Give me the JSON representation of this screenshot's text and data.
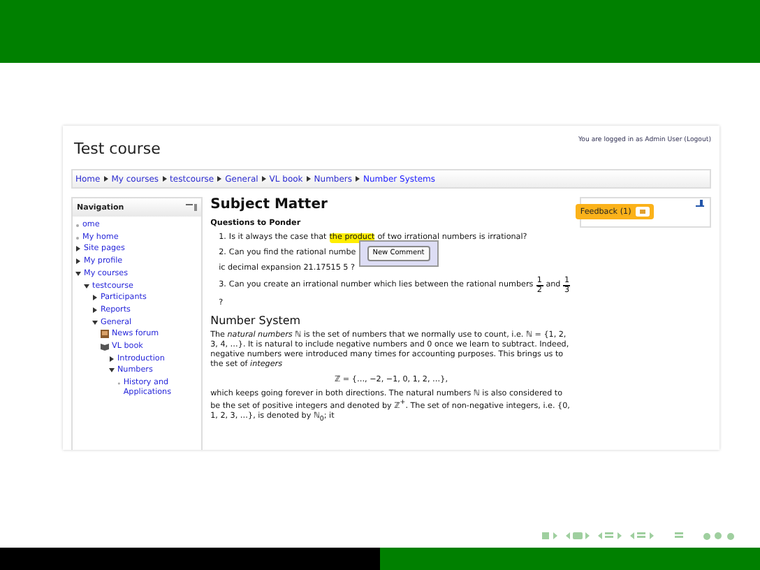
{
  "page": {
    "title": "Test course",
    "login": "You are logged in as Admin User (Logout)"
  },
  "breadcrumb": [
    "Home",
    "My courses",
    "testcourse",
    "General",
    "VL book",
    "Numbers",
    "Number Systems"
  ],
  "navigation": {
    "title": "Navigation",
    "items": [
      {
        "label": "ome",
        "kind": "link"
      },
      {
        "label": "My home",
        "kind": "link"
      },
      {
        "label": "Site pages",
        "kind": "node",
        "expanded": false
      },
      {
        "label": "My profile",
        "kind": "node",
        "expanded": false
      },
      {
        "label": "My courses",
        "kind": "node",
        "expanded": true,
        "children": [
          {
            "label": "testcourse",
            "kind": "node",
            "expanded": true,
            "children": [
              {
                "label": "Participants",
                "kind": "node",
                "expanded": false
              },
              {
                "label": "Reports",
                "kind": "node",
                "expanded": false
              },
              {
                "label": "General",
                "kind": "node",
                "expanded": true,
                "children": [
                  {
                    "label": "News forum",
                    "kind": "forum"
                  },
                  {
                    "label": "VL book",
                    "kind": "book",
                    "children": [
                      {
                        "label": "Introduction",
                        "kind": "node",
                        "expanded": false
                      },
                      {
                        "label": "Numbers",
                        "kind": "node",
                        "expanded": true,
                        "children": [
                          {
                            "label": "History and Applications",
                            "kind": "link"
                          }
                        ]
                      }
                    ]
                  }
                ]
              }
            ]
          }
        ]
      }
    ]
  },
  "content": {
    "title": "Subject Matter",
    "subtitle": "Questions to Ponder",
    "questions": [
      {
        "number": "1.",
        "parts": [
          {
            "text": "Is it always the case that "
          },
          {
            "text": "the product",
            "highlighted": true
          },
          {
            "text": " of two irrational numbers is irrational?"
          }
        ]
      },
      {
        "number": "2.",
        "parts": [
          {
            "text": "Can you find the rational numbe"
          },
          {
            "text": "New Comment",
            "kind": "popup"
          },
          {
            "text": "ic decimal expansion 21.17515 5 ?"
          }
        ]
      },
      {
        "number": "3.",
        "parts": [
          {
            "text": "Can you create an irrational number which lies between the rational numbers "
          },
          {
            "kind": "fraction",
            "numerator": "1",
            "denominator": "2"
          },
          {
            "text": " and "
          },
          {
            "kind": "fraction",
            "numerator": "1",
            "denominator": "3"
          },
          {
            "text": " ?"
          }
        ]
      }
    ],
    "section": "Number System",
    "paragraph1": "The *natural numbers* ℕ is the set of numbers that we normally use to count, i.e. ℕ = {1, 2, 3, 4, …}. It is natural to include negative numbers and 0 once we learn to subtract. Indeed, negative numbers were introduced many times for accounting purposes. This brings us to the set of *integers*",
    "formula": "ℤ = {…, −2, −1, 0, 1, 2, …},",
    "paragraph2": "which keeps going forever in both directions. The natural numbers ℕ is also considered to be the set of positive integers and denoted by ℤ$^{+}$. The set of non-negative integers, i.e. {0, 1, 2, 3, …}, is denoted by ℕ$_{0}$; it"
  },
  "feedback": {
    "label": "Feedback (1)"
  }
}
